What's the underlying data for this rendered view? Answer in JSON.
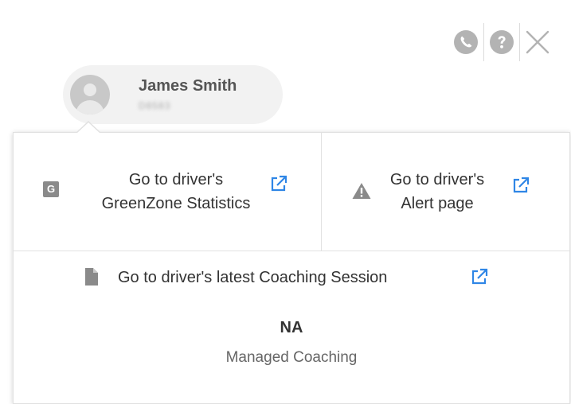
{
  "toolbar": {
    "icons": [
      "phone-icon",
      "help-icon",
      "close-icon"
    ],
    "icon_color": "#b3b3b3"
  },
  "driver": {
    "name": "James Smith",
    "id": "D8583"
  },
  "links": {
    "greenzone": {
      "badge": "G",
      "line1": "Go to driver's",
      "line2": "GreenZone Statistics"
    },
    "alert": {
      "line1": "Go to driver's",
      "line2": "Alert page"
    },
    "coaching": {
      "label": "Go to driver's latest Coaching Session"
    }
  },
  "coaching_status": {
    "value": "NA",
    "label": "Managed Coaching"
  },
  "colors": {
    "link_icon": "#2f86e6",
    "icon_gray": "#8a8a8a"
  }
}
